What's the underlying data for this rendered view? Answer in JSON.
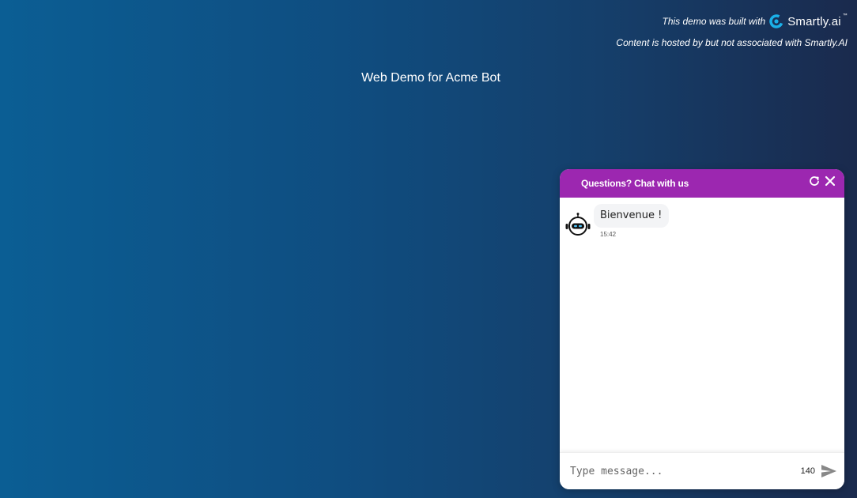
{
  "attribution": {
    "built_with": "This demo was built with",
    "brand_name": "Smartly.ai",
    "brand_tm": "™",
    "hosted_notice": "Content is hosted by but not associated with Smartly.AI"
  },
  "page": {
    "title": "Web Demo for Acme Bot"
  },
  "chat": {
    "header_title": "Questions? Chat with us",
    "messages": [
      {
        "sender": "bot",
        "text": "Bienvenue !",
        "time": "15:42"
      }
    ],
    "composer": {
      "placeholder": "Type message...",
      "char_count": "140"
    }
  },
  "colors": {
    "header": "#9c27b0",
    "brand_accent": "#1ab0e8"
  },
  "icons": {
    "refresh": "refresh-icon",
    "close": "close-icon",
    "send": "send-icon",
    "bot": "robot-icon",
    "logo": "smartly-logo-icon"
  }
}
